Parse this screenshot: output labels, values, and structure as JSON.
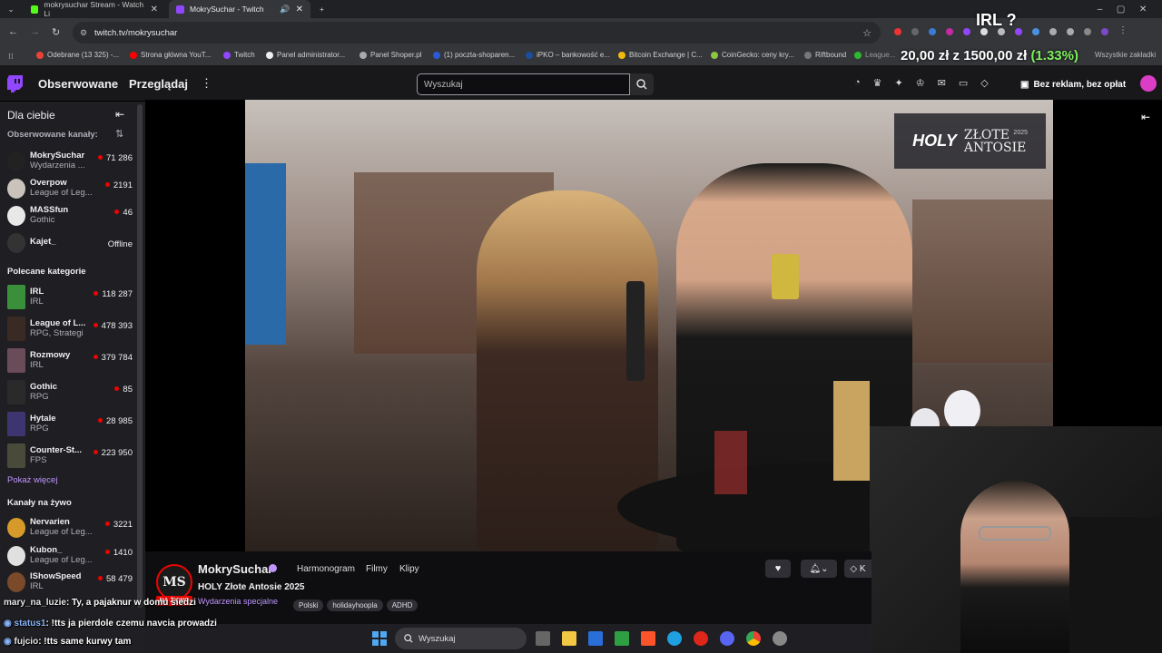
{
  "browser": {
    "tabs": [
      {
        "title": "mokrysuchar Stream - Watch Li",
        "close": "✕"
      },
      {
        "title": "MokrySuchar - Twitch",
        "close": "✕"
      }
    ],
    "new_tab": "+",
    "url": "twitch.tv/mokrysuchar",
    "bookmarks": [
      "Odebrane (13 325) -...",
      "Strona główna YouT...",
      "Twitch",
      "Panel administrator...",
      "Panel Shoper.pl",
      "(1) poczta-shoparen...",
      "iPKO – bankowość e...",
      "Bitcoin Exchange | C...",
      "CoinGecko: ceny kry...",
      "Riftbound",
      "League...",
      "Wszystkie zakładki"
    ],
    "overlay_question": "IRL ?",
    "overlay_donation": "20,00 zł z 1500,00 zł",
    "overlay_percent": "(1.33%)"
  },
  "twitch_nav": {
    "followed": "Obserwowane",
    "browse": "Przeglądaj",
    "search_placeholder": "Wyszukaj",
    "no_ads": "Bez reklam, bez opłat"
  },
  "sidebar": {
    "title": "Dla ciebie",
    "followed_label": "Obserwowane kanały:",
    "followed": [
      {
        "name": "MokrySuchar",
        "sub": "Wydarzenia ...",
        "viewers": "71 286",
        "color": "#222"
      },
      {
        "name": "Overpow",
        "sub": "League of Leg...",
        "viewers": "2191",
        "color": "#c9c3bb"
      },
      {
        "name": "MASSfun",
        "sub": "Gothic",
        "viewers": "46",
        "color": "#e8e8e8"
      },
      {
        "name": "Kajet_",
        "sub": "",
        "viewers": "Offline",
        "color": "#333"
      }
    ],
    "recommended_label": "Polecane kategorie",
    "categories": [
      {
        "name": "IRL",
        "sub": "IRL",
        "viewers": "118 287",
        "color": "#3a8f3a"
      },
      {
        "name": "League of L...",
        "sub": "RPG, Strategi",
        "viewers": "478 393",
        "color": "#3a2a24"
      },
      {
        "name": "Rozmowy",
        "sub": "IRL",
        "viewers": "379 784",
        "color": "#6a4c58"
      },
      {
        "name": "Gothic",
        "sub": "RPG",
        "viewers": "85",
        "color": "#2a2a2a"
      },
      {
        "name": "Hytale",
        "sub": "RPG",
        "viewers": "28 985",
        "color": "#3d3570"
      },
      {
        "name": "Counter-St...",
        "sub": "FPS",
        "viewers": "223 950",
        "color": "#4a4a3a"
      }
    ],
    "show_more": "Pokaż więcej",
    "live_label": "Kanały na żywo",
    "live": [
      {
        "name": "Nervarien",
        "sub": "League of Leg...",
        "viewers": "3221",
        "color": "#d79a2a"
      },
      {
        "name": "Kubon_",
        "sub": "League of Leg...",
        "viewers": "1410",
        "color": "#e0e0e0"
      },
      {
        "name": "IShowSpeed",
        "sub": "IRL",
        "viewers": "58 479",
        "color": "#7a4a2a"
      }
    ]
  },
  "video": {
    "brand_holy": "HOLY",
    "brand_event": "ZŁOTE ANTOSIE",
    "brand_year": "2025"
  },
  "channel": {
    "avatar_text": "MS",
    "live_badge": "NA ŻYWO",
    "name": "MokrySuchar",
    "tab_schedule": "Harmonogram",
    "tab_videos": "Filmy",
    "tab_clips": "Klipy",
    "title": "HOLY Złote Antosie 2025",
    "category": "Wydarzenia specjalne",
    "tags": [
      "Polski",
      "holidayhoopla",
      "ADHD"
    ]
  },
  "chat": [
    {
      "user": "mary_na_luzie",
      "text": ": Ty, a pajaknur w domu siedzi"
    },
    {
      "user": "status1",
      "text": ": !tts ja pierdole czemu navcia prowadzi"
    },
    {
      "user": "fujcio",
      "text": ": !tts same kurwy tam"
    }
  ],
  "taskbar": {
    "search": "Wyszukaj"
  }
}
